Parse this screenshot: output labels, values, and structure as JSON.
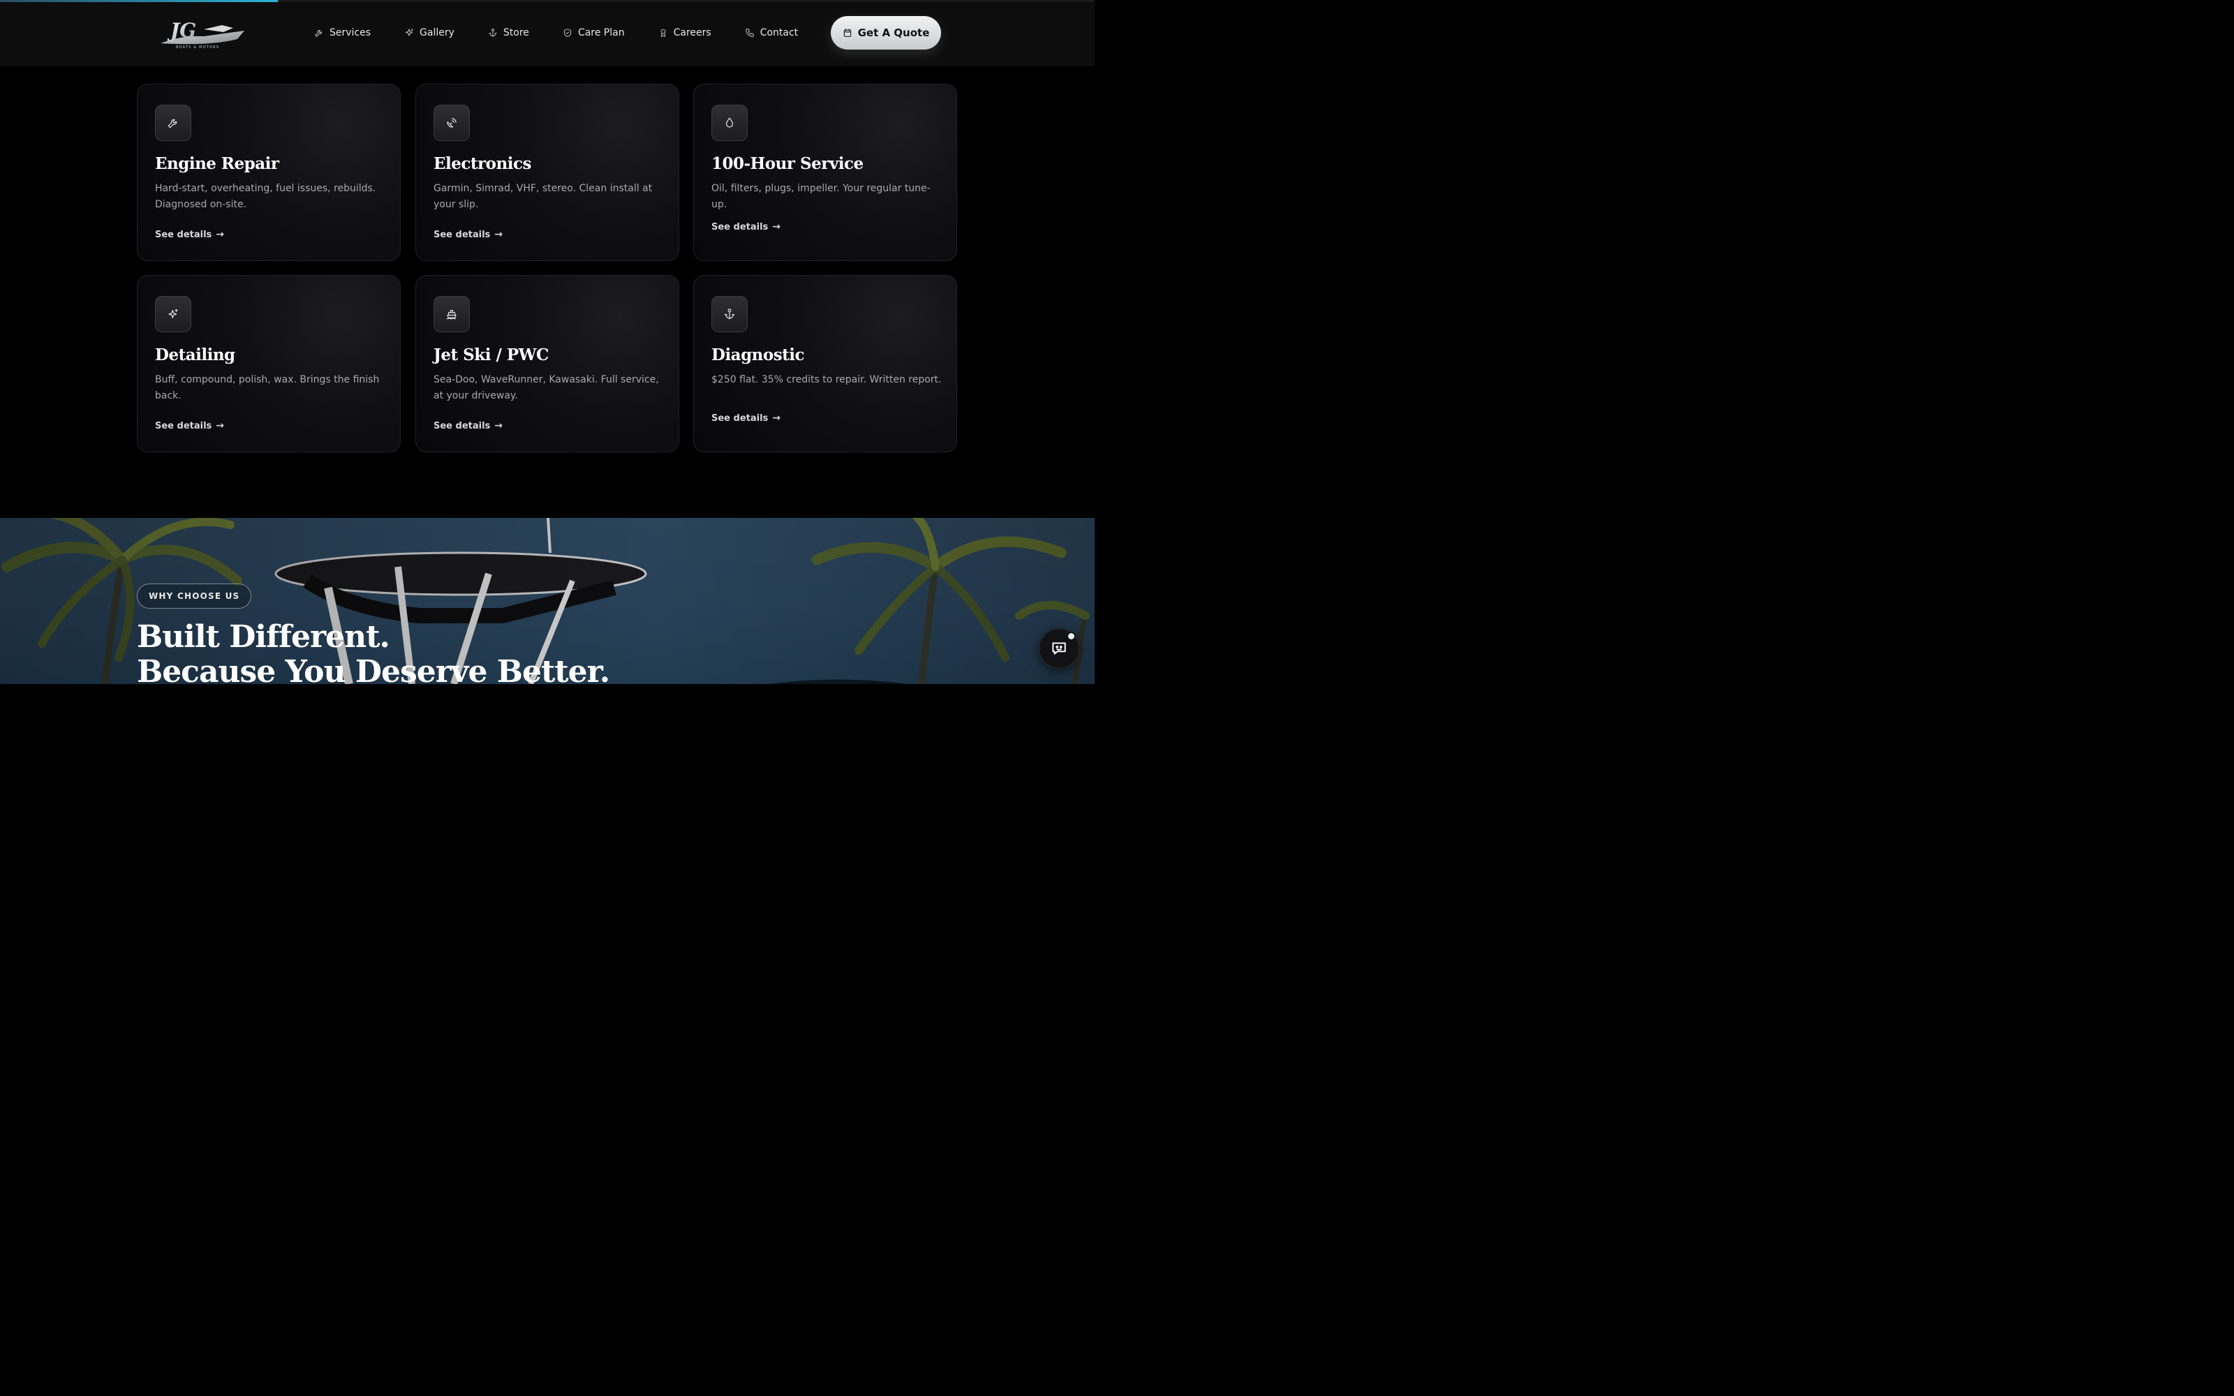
{
  "progress": {
    "fraction": 0.254
  },
  "brand": {
    "logo_text": "JG",
    "logo_sub": "BOATS & MOTORS"
  },
  "nav": {
    "items": [
      {
        "label": "Services",
        "icon": "wrench-icon"
      },
      {
        "label": "Gallery",
        "icon": "sparkle-icon"
      },
      {
        "label": "Store",
        "icon": "anchor-icon"
      },
      {
        "label": "Care Plan",
        "icon": "shield-icon"
      },
      {
        "label": "Careers",
        "icon": "award-icon"
      },
      {
        "label": "Contact",
        "icon": "phone-icon"
      }
    ],
    "cta_label": "Get A Quote",
    "cta_icon": "calendar-icon"
  },
  "services": [
    {
      "title": "Engine Repair",
      "description": "Hard-start, overheating, fuel issues, rebuilds. Diagnosed on-site.",
      "link": "See details",
      "icon": "wrench-icon"
    },
    {
      "title": "Electronics",
      "description": "Garmin, Simrad, VHF, stereo. Clean install at your slip.",
      "link": "See details",
      "icon": "satellite-dish-icon"
    },
    {
      "title": "100-Hour Service",
      "description": "Oil, filters, plugs, impeller. Your regular tune-up.",
      "link": "See details",
      "icon": "droplet-icon"
    },
    {
      "title": "Detailing",
      "description": "Buff, compound, polish, wax. Brings the finish back.",
      "link": "See details",
      "icon": "sparkle-icon"
    },
    {
      "title": "Jet Ski / PWC",
      "description": "Sea-Doo, WaveRunner, Kawasaki. Full service, at your driveway.",
      "link": "See details",
      "icon": "ship-icon"
    },
    {
      "title": "Diagnostic",
      "description": "$250 flat. 35% credits to repair. Written report.",
      "link": "See details",
      "icon": "anchor-icon"
    }
  ],
  "why": {
    "badge": "WHY CHOOSE US",
    "title_line1": "Built Different.",
    "title_line2": "Because You Deserve Better."
  },
  "chat": {
    "icon": "chat-bot-icon"
  }
}
